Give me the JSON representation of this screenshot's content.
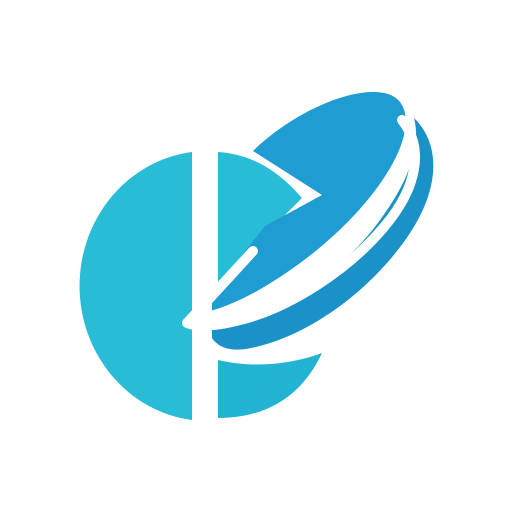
{
  "logo": {
    "name": "pill-logo",
    "colors": {
      "background": "#ffffff",
      "light_teal": "#28bcd7",
      "teal_mid": "#22b3d2",
      "blue": "#1f9dd3",
      "blue_edge": "#1a92c7",
      "gap": "#ffffff"
    },
    "icons": [
      "pill-icon",
      "split-circle-icon"
    ]
  }
}
